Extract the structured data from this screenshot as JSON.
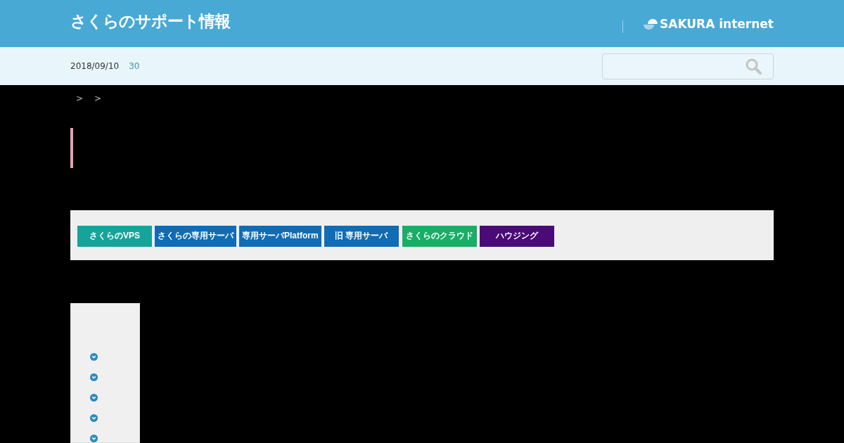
{
  "header": {
    "site_title": "さくらのサポート情報",
    "brand": "SAKURA internet"
  },
  "subbar": {
    "date": "2018/09/10",
    "count": "30"
  },
  "breadcrumb": {
    "separators": [
      ">",
      ">"
    ]
  },
  "service_buttons": [
    {
      "label": "さくらのVPS",
      "color": "#16a39a"
    },
    {
      "label": "さくらの専用サーバ",
      "color": "#0f6cb5"
    },
    {
      "label": "専用サーバPlatform",
      "color": "#0f6cb5"
    },
    {
      "label": "旧 専用サーバ",
      "color": "#0f6cb5"
    },
    {
      "label": "さくらのクラウド",
      "color": "#19ae66"
    },
    {
      "label": "ハウジング",
      "color": "#4a0a78"
    }
  ]
}
